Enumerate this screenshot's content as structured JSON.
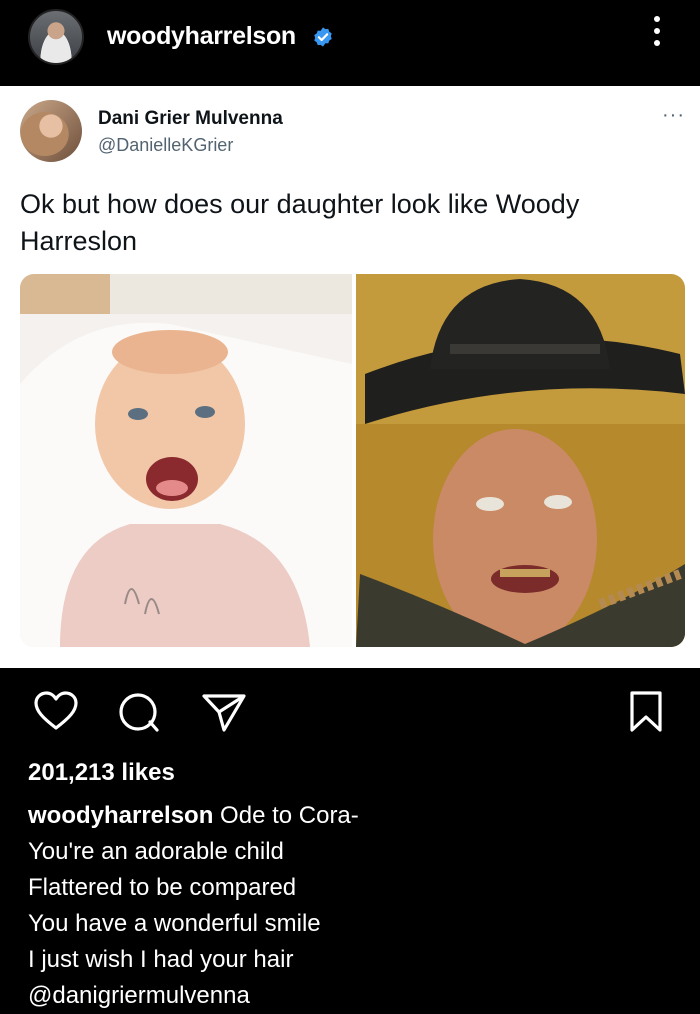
{
  "header": {
    "username": "woodyharrelson"
  },
  "tweet": {
    "name": "Dani Grier Mulvenna",
    "handle": "@DanielleKGrier",
    "more": "···",
    "text": "Ok but how does our daughter look like Woody Harreslon"
  },
  "post": {
    "likes": "201,213 likes",
    "caption_user": "woodyharrelson",
    "caption_lines": [
      "Ode to Cora-",
      "You're an adorable child",
      "Flattered to be compared",
      "You have a wonderful smile",
      "I just wish I had your hair",
      "@danigriermulvenna"
    ]
  },
  "icons": {
    "header": [
      "verified-badge-icon",
      "more-options-icon"
    ],
    "actions": [
      "heart-icon",
      "comment-icon",
      "share-icon",
      "bookmark-icon"
    ]
  },
  "colors": {
    "background": "#000000",
    "verified": "#3897f0",
    "tweet_bg": "#ffffff",
    "handle_gray": "#536471"
  }
}
